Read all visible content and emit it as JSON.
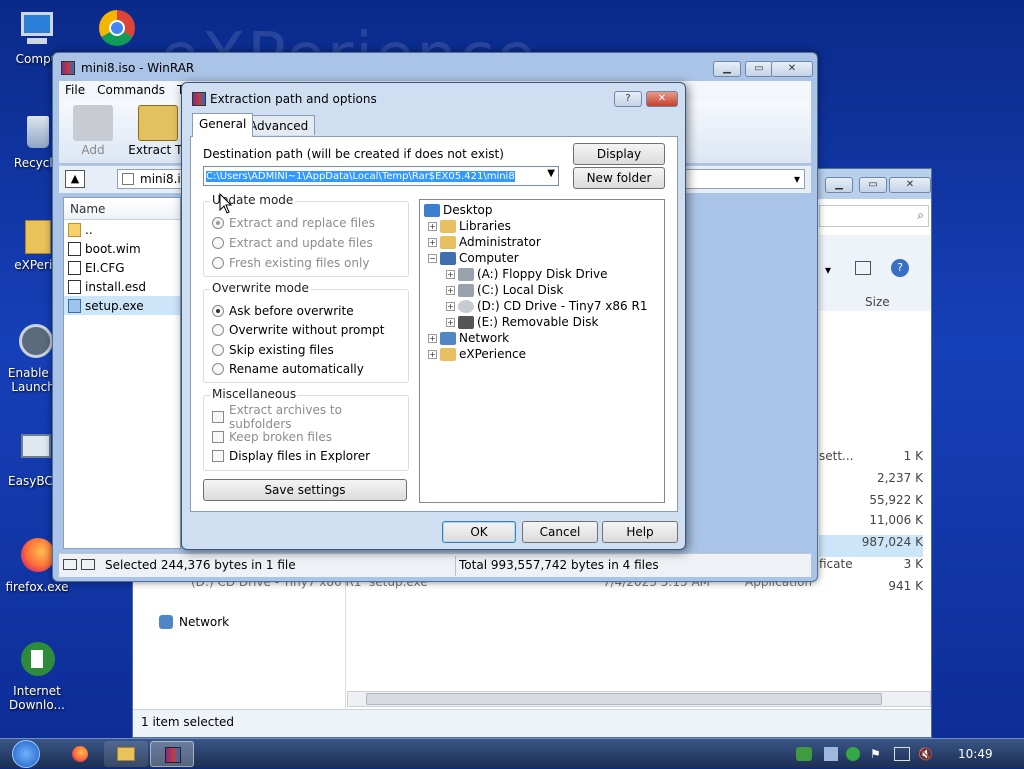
{
  "desktop": {
    "watermark": "eXPerience",
    "icons": [
      {
        "label": "Compu"
      },
      {
        "label": ""
      },
      {
        "label": "Recycle"
      },
      {
        "label": "eXPerie"
      },
      {
        "label": "Enable Q Launch."
      },
      {
        "label": "EasyBCD"
      },
      {
        "label": "firefox.exe"
      },
      {
        "label": "Internet Downlo..."
      }
    ]
  },
  "explorer": {
    "network_label": "Network",
    "status": "1 item selected",
    "size_header": "Size",
    "bg_row_drive": "(D:) CD Drive - Tiny7 x86 R1",
    "bg_row_file": "setup.exe",
    "bg_row_date": "7/4/2023 5:15 AM",
    "bg_row_type": "Application",
    "rows": [
      {
        "type": "sett...",
        "size": "1 K"
      },
      {
        "type": "",
        "size": "2,237 K"
      },
      {
        "type": "",
        "size": "55,922 K"
      },
      {
        "type": "",
        "size": "11,006 K"
      },
      {
        "type": "",
        "size": "987,024 K"
      },
      {
        "type": "ficate",
        "size": "3 K"
      },
      {
        "type": "",
        "size": "941 K"
      }
    ]
  },
  "winrar": {
    "title": "mini8.iso - WinRAR",
    "menu": [
      "File",
      "Commands",
      "T"
    ],
    "tools": [
      "Add",
      "Extract To"
    ],
    "address": "mini8.iso",
    "column_name": "Name",
    "files": [
      "..",
      "boot.wim",
      "EI.CFG",
      "install.esd",
      "setup.exe"
    ],
    "status_left": "Selected 244,376 bytes in 1 file",
    "status_right": "Total 993,557,742 bytes in 4 files"
  },
  "dialog": {
    "title": "Extraction path and options",
    "help_btn": "?",
    "tabs": [
      "General",
      "Advanced"
    ],
    "dest_label": "Destination path (will be created if does not exist)",
    "dest_value": "C:\\Users\\ADMINI~1\\AppData\\Local\\Temp\\Rar$EX05.421\\mini8",
    "display_btn": "Display",
    "newfolder_btn": "New folder",
    "update_mode": {
      "label": "Update mode",
      "options": [
        "Extract and replace files",
        "Extract and update files",
        "Fresh existing files only"
      ]
    },
    "overwrite_mode": {
      "label": "Overwrite mode",
      "options": [
        "Ask before overwrite",
        "Overwrite without prompt",
        "Skip existing files",
        "Rename automatically"
      ]
    },
    "misc": {
      "label": "Miscellaneous",
      "options": [
        "Extract archives to subfolders",
        "Keep broken files",
        "Display files in Explorer"
      ]
    },
    "save_btn": "Save settings",
    "tree": [
      "Desktop",
      "Libraries",
      "Administrator",
      "Computer",
      "(A:) Floppy Disk Drive",
      "(C:) Local Disk",
      "(D:) CD Drive - Tiny7 x86 R1",
      "(E:) Removable Disk",
      "Network",
      "eXPerience"
    ],
    "ok_btn": "OK",
    "cancel_btn": "Cancel",
    "help_label": "Help"
  },
  "taskbar": {
    "clock": "10:49"
  }
}
